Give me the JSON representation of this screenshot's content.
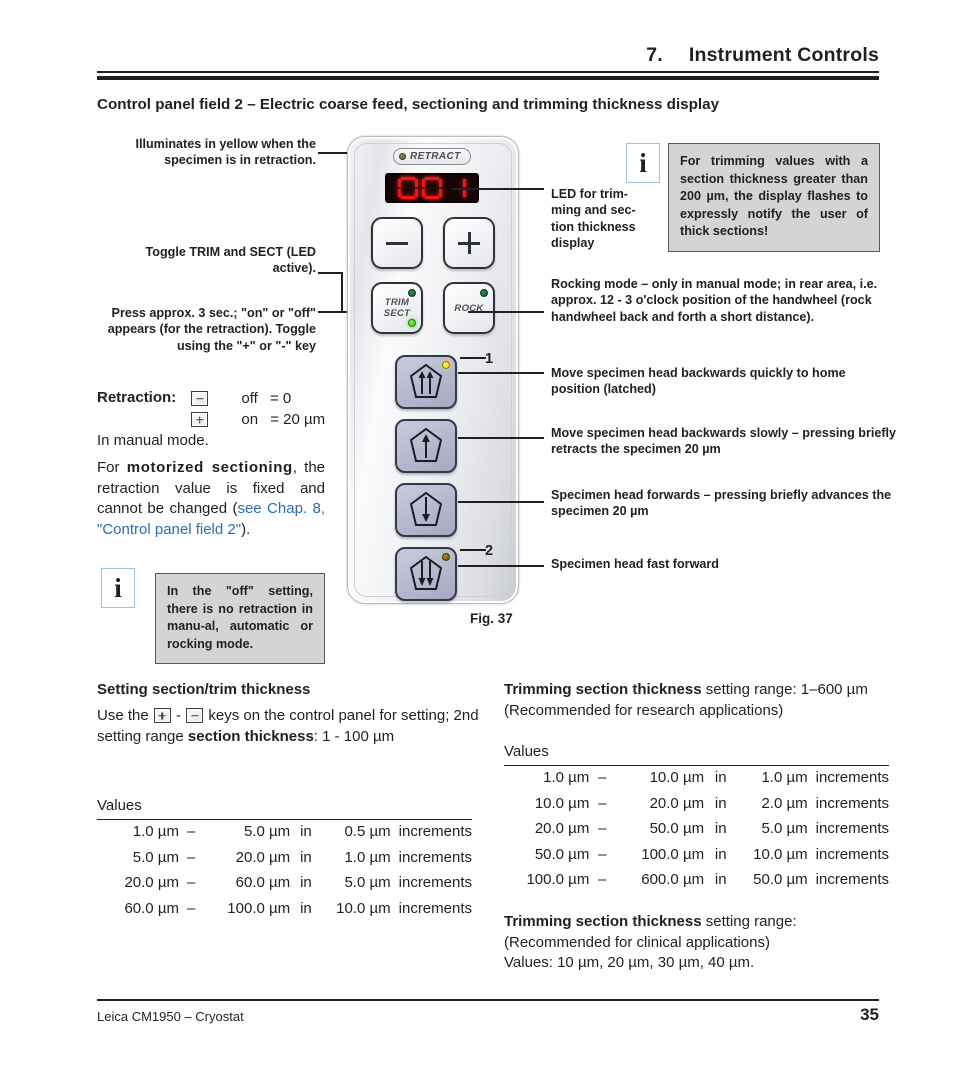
{
  "header": {
    "chapter_number": "7.",
    "chapter_title": "Instrument Controls",
    "section_title": "Control panel field 2 – Electric coarse feed, sectioning and trimming thickness display"
  },
  "panel": {
    "retract_label": "RETRACT",
    "display_value": "001",
    "minus_key": "−",
    "plus_key": "+",
    "trim_line1": "TRIM",
    "trim_line2": "SECT",
    "rock_label": "ROCK",
    "marker_1": "1",
    "marker_2": "2",
    "figure_caption": "Fig. 37"
  },
  "callouts_left": {
    "retract_led": "Illuminates in yellow when the specimen is in retraction.",
    "toggle_trim_sect": "Toggle TRIM and SECT (LED active).",
    "press_3_sec": "Press approx. 3 sec.; \"on\" or \"off\" appears (for the retraction). Toggle using the \"+\" or \"-\" key"
  },
  "callouts_right": {
    "led_display": "LED for trim-ming and sec-tion thickness display",
    "rocking_mode": "Rocking mode – only in manual mode; in rear area, i.e. approx. 12 - 3 o'clock position of the handwheel (rock handwheel back and forth a short distance).",
    "head_back_fast": "Move specimen head backwards quickly to home position (latched)",
    "head_back_slow": "Move specimen head backwards slowly – pressing briefly retracts the specimen 20 µm",
    "head_forward": "Specimen head forwards – pressing briefly advances the specimen 20 µm",
    "head_fast_forward": "Specimen head fast forward"
  },
  "notes": {
    "trimming_flash": "For trimming values with a section thickness greater than 200 µm, the display flashes to expressly notify the user of thick sections!",
    "off_setting": "In the \"off\" setting, there is no retraction in manu-al, automatic or rocking mode.",
    "info_icon_glyph": "i"
  },
  "retraction": {
    "label": "Retraction",
    "colon": ":",
    "off_word": "off",
    "off_value": "= 0",
    "on_word": "on",
    "on_value": "= 20 µm",
    "manual_mode": "In manual mode.",
    "motorized_pre": "For ",
    "motorized_bold": "motorized sectioning",
    "motorized_post": ", the retraction value is fixed and cannot be changed (",
    "link_text": "see Chap. 8, \"Control panel field 2\"",
    "motorized_end": ")."
  },
  "setting_section": {
    "heading": "Setting section/trim thickness",
    "use_the": "Use the",
    "dash": "-",
    "keys_text": "keys on the control panel for setting; 2nd setting range ",
    "bold_term": "section thickness",
    "range_text": ": 1 - 100 µm",
    "values_label": "Values",
    "rows": [
      {
        "from": "1.0 µm",
        "dash": "–",
        "to": "5.0 µm",
        "in": "in",
        "inc": "0.5 µm",
        "word": "increments"
      },
      {
        "from": "5.0 µm",
        "dash": "–",
        "to": "20.0 µm",
        "in": "in",
        "inc": "1.0 µm",
        "word": "increments"
      },
      {
        "from": "20.0 µm",
        "dash": "–",
        "to": "60.0 µm",
        "in": "in",
        "inc": "5.0 µm",
        "word": "increments"
      },
      {
        "from": "60.0 µm",
        "dash": "–",
        "to": "100.0 µm",
        "in": "in",
        "inc": "10.0 µm",
        "word": "increments"
      }
    ]
  },
  "trimming_research": {
    "bold_term": "Trimming section thickness",
    "range_text": " setting range: 1–600 µm",
    "recommended": "(Recommended for research applications)",
    "values_label": "Values",
    "rows": [
      {
        "from": "1.0 µm",
        "dash": "–",
        "to": "10.0 µm",
        "in": "in",
        "inc": "1.0 µm",
        "word": "increments"
      },
      {
        "from": "10.0 µm",
        "dash": "–",
        "to": "20.0 µm",
        "in": "in",
        "inc": "2.0 µm",
        "word": "increments"
      },
      {
        "from": "20.0 µm",
        "dash": "–",
        "to": "50.0 µm",
        "in": "in",
        "inc": "5.0 µm",
        "word": "increments"
      },
      {
        "from": "50.0 µm",
        "dash": "–",
        "to": "100.0 µm",
        "in": "in",
        "inc": "10.0 µm",
        "word": "increments"
      },
      {
        "from": "100.0 µm",
        "dash": "–",
        "to": "600.0 µm",
        "in": "in",
        "inc": "50.0 µm",
        "word": "increments"
      }
    ]
  },
  "trimming_clinical": {
    "bold_term": "Trimming section thickness",
    "range_text": " setting range:",
    "recommended": "(Recommended for clinical applications)",
    "values_line": "Values: 10 µm, 20 µm, 30 µm, 40 µm."
  },
  "footer": {
    "left": "Leica CM1950 – Cryostat",
    "page": "35"
  },
  "colors": {
    "text": "#231f20",
    "link": "#2b6cb5",
    "note_bg": "#d4d4d4",
    "led_red": "#f01414",
    "led_yellow": "#f5c518",
    "led_green": "#2bc417"
  }
}
